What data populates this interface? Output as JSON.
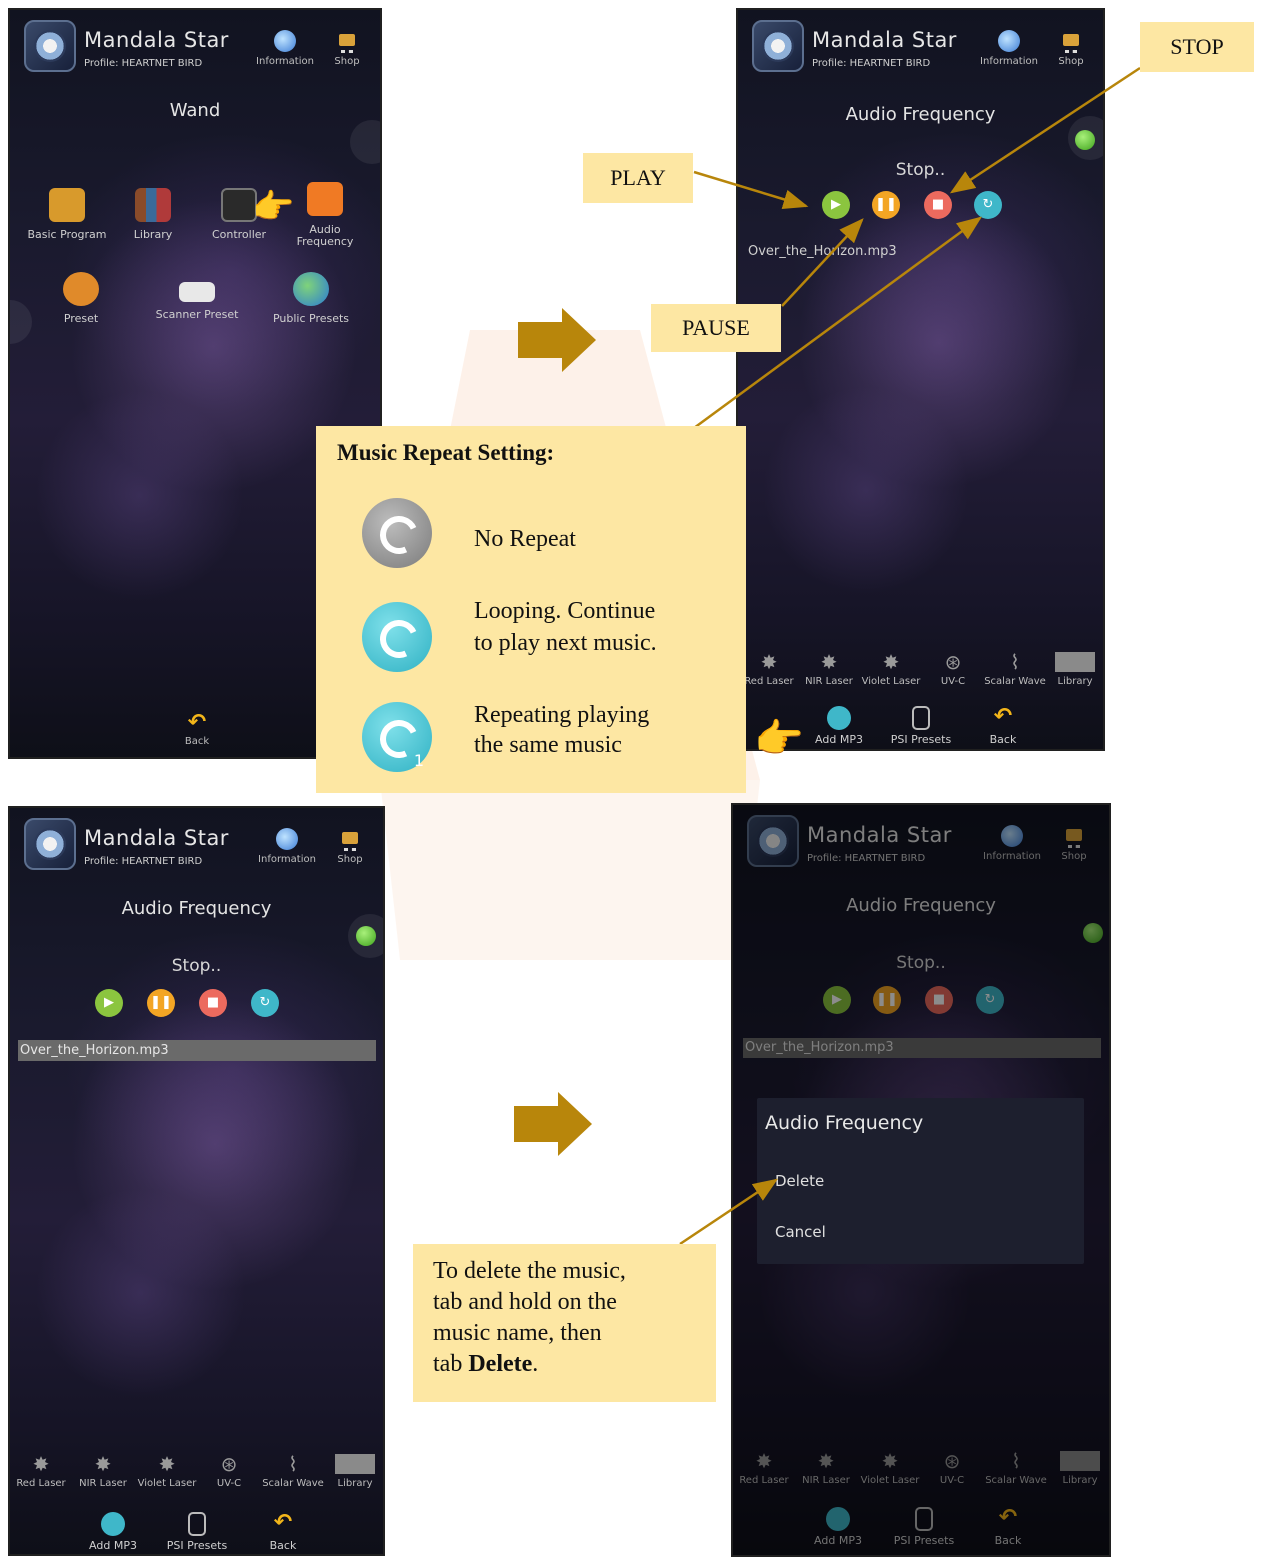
{
  "colors": {
    "callout_bg": "#fde7a3",
    "arrow": "#b8860b",
    "play": "#8bc53f",
    "pause": "#f3a524",
    "stop": "#ec6a5e",
    "repeat": "#3fb7c9"
  },
  "app": {
    "name": "Mandala Star",
    "profile": "Profile: HEARTNET BIRD",
    "info_label": "Information",
    "shop_label": "Shop"
  },
  "wand_screen": {
    "title": "Wand",
    "items": [
      "Basic Program",
      "Library",
      "Controller",
      "Audio\nFrequency",
      "Preset",
      "Scanner Preset",
      "Public Presets"
    ],
    "back": "Back"
  },
  "audio_screen": {
    "title": "Audio Frequency",
    "status": "Stop..",
    "file": "Over_the_Horizon.mp3",
    "lasers": [
      "Red Laser",
      "NIR Laser",
      "Violet Laser",
      "UV-C",
      "Scalar Wave",
      "Library"
    ],
    "dock": [
      "Add MP3",
      "PSI Presets",
      "Back"
    ]
  },
  "dialog": {
    "title": "Audio Frequency",
    "delete": "Delete",
    "cancel": "Cancel"
  },
  "callouts": {
    "play": "PLAY",
    "pause": "PAUSE",
    "stop": "STOP",
    "repeat_title": "Music Repeat Setting:",
    "no_repeat": "No Repeat",
    "looping_1": "Looping. Continue",
    "looping_2": "to play next music.",
    "repeating_1": "Repeating playing",
    "repeating_2": "the same music",
    "repeat_one": "1",
    "delete_1": "To delete the music,",
    "delete_2": "tab and hold on the",
    "delete_3": "music name, then",
    "delete_4_pre": "tab",
    "delete_4_bold": "Delete",
    "delete_4_post": "."
  }
}
